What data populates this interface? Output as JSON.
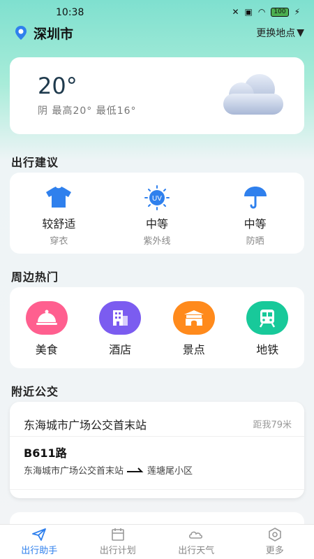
{
  "status": {
    "time": "10:38",
    "battery": "100"
  },
  "location": {
    "city": "深圳市",
    "change_label": "更换地点"
  },
  "weather": {
    "temp": "20°",
    "desc": "阴  最高20° 最低16°"
  },
  "sections": {
    "advice": "出行建议",
    "hot": "周边热门",
    "bus": "附近公交"
  },
  "advice": [
    {
      "value": "较舒适",
      "label": "穿衣",
      "icon": "shirt-icon"
    },
    {
      "value": "中等",
      "label": "紫外线",
      "icon": "uv-icon",
      "badge": "UV"
    },
    {
      "value": "中等",
      "label": "防晒",
      "icon": "umbrella-icon"
    }
  ],
  "hot": [
    {
      "label": "美食",
      "icon": "food-icon",
      "color": "#ff5f8f"
    },
    {
      "label": "酒店",
      "icon": "hotel-icon",
      "color": "#7b5cf0"
    },
    {
      "label": "景点",
      "icon": "scenic-icon",
      "color": "#ff8a1c"
    },
    {
      "label": "地铁",
      "icon": "subway-icon",
      "color": "#18c99a"
    }
  ],
  "bus": {
    "station": "东海城市广场公交首末站",
    "distance": "距我79米",
    "route": "B611路",
    "from": "东海城市广场公交首末站",
    "to": "莲塘尾小区"
  },
  "tabs": [
    {
      "label": "出行助手",
      "icon": "send-icon",
      "active": true
    },
    {
      "label": "出行计划",
      "icon": "calendar-icon",
      "active": false
    },
    {
      "label": "出行天气",
      "icon": "weather-icon",
      "active": false
    },
    {
      "label": "更多",
      "icon": "more-icon",
      "active": false
    }
  ],
  "colors": {
    "accent": "#2f80ed",
    "header_gradient": "#7fe0cf"
  }
}
